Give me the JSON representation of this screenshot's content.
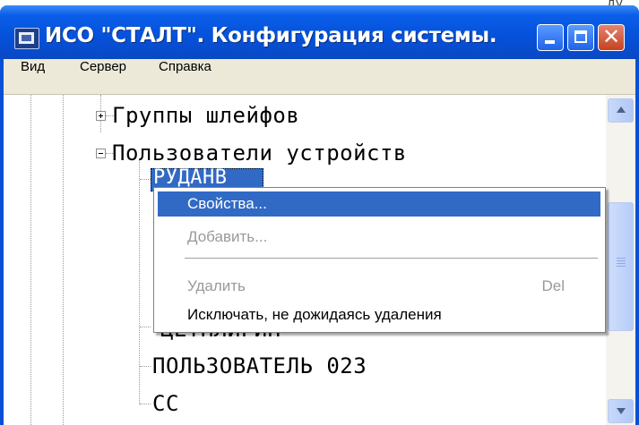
{
  "window": {
    "title": "ИСО \"СТАЛТ\". Конфигурация системы.",
    "background_fragment": "ду"
  },
  "menubar": {
    "items": [
      "Вид",
      "Сервер",
      "Справка"
    ]
  },
  "tree": {
    "nodes": {
      "groups": "Группы шлейфов",
      "users": "Пользователи устройств",
      "selected": "РУДАНВ",
      "child_partial": "ЦЕТНЛИГИН",
      "user_023": "ПОЛЬЗОВАТЕЛЬ 023",
      "cc": "СС"
    }
  },
  "context_menu": {
    "items": [
      {
        "label": "Свойства...",
        "state": "highlighted"
      },
      {
        "label": "Добавить...",
        "state": "disabled"
      },
      {
        "label": "Удалить",
        "shortcut": "Del",
        "state": "disabled"
      },
      {
        "label": "Исключать, не дожидаясь удаления",
        "state": "enabled"
      }
    ]
  },
  "colors": {
    "titlebar": "#0552dc",
    "highlight": "#316ac5",
    "menubar": "#ece9d8",
    "close_button": "#c5421f"
  },
  "icons": [
    "app-icon",
    "minimize-icon",
    "maximize-icon",
    "close-icon",
    "expand-plus-icon",
    "collapse-minus-icon",
    "scroll-up-icon",
    "scroll-down-icon"
  ]
}
